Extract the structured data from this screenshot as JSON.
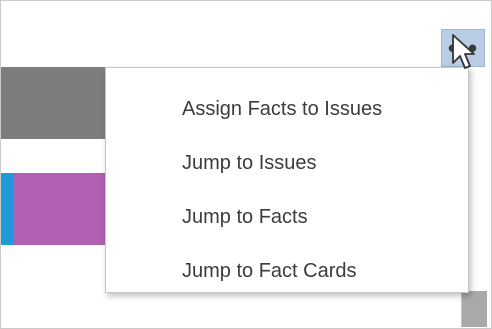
{
  "toolbar": {
    "more_button_label": "•••",
    "more_button_icon": "more-options-icon"
  },
  "menu": {
    "items": [
      {
        "label": "Assign Facts to Issues"
      },
      {
        "label": "Jump to Issues"
      },
      {
        "label": "Jump to Facts"
      },
      {
        "label": "Jump to Fact Cards"
      }
    ]
  },
  "colors": {
    "gray_block": "#7d7d7d",
    "purple_block": "#b05fb2",
    "accent_bar": "#1e9ad6",
    "more_button_bg": "#b9cde5"
  },
  "cursor_icon": "mouse-pointer-icon"
}
